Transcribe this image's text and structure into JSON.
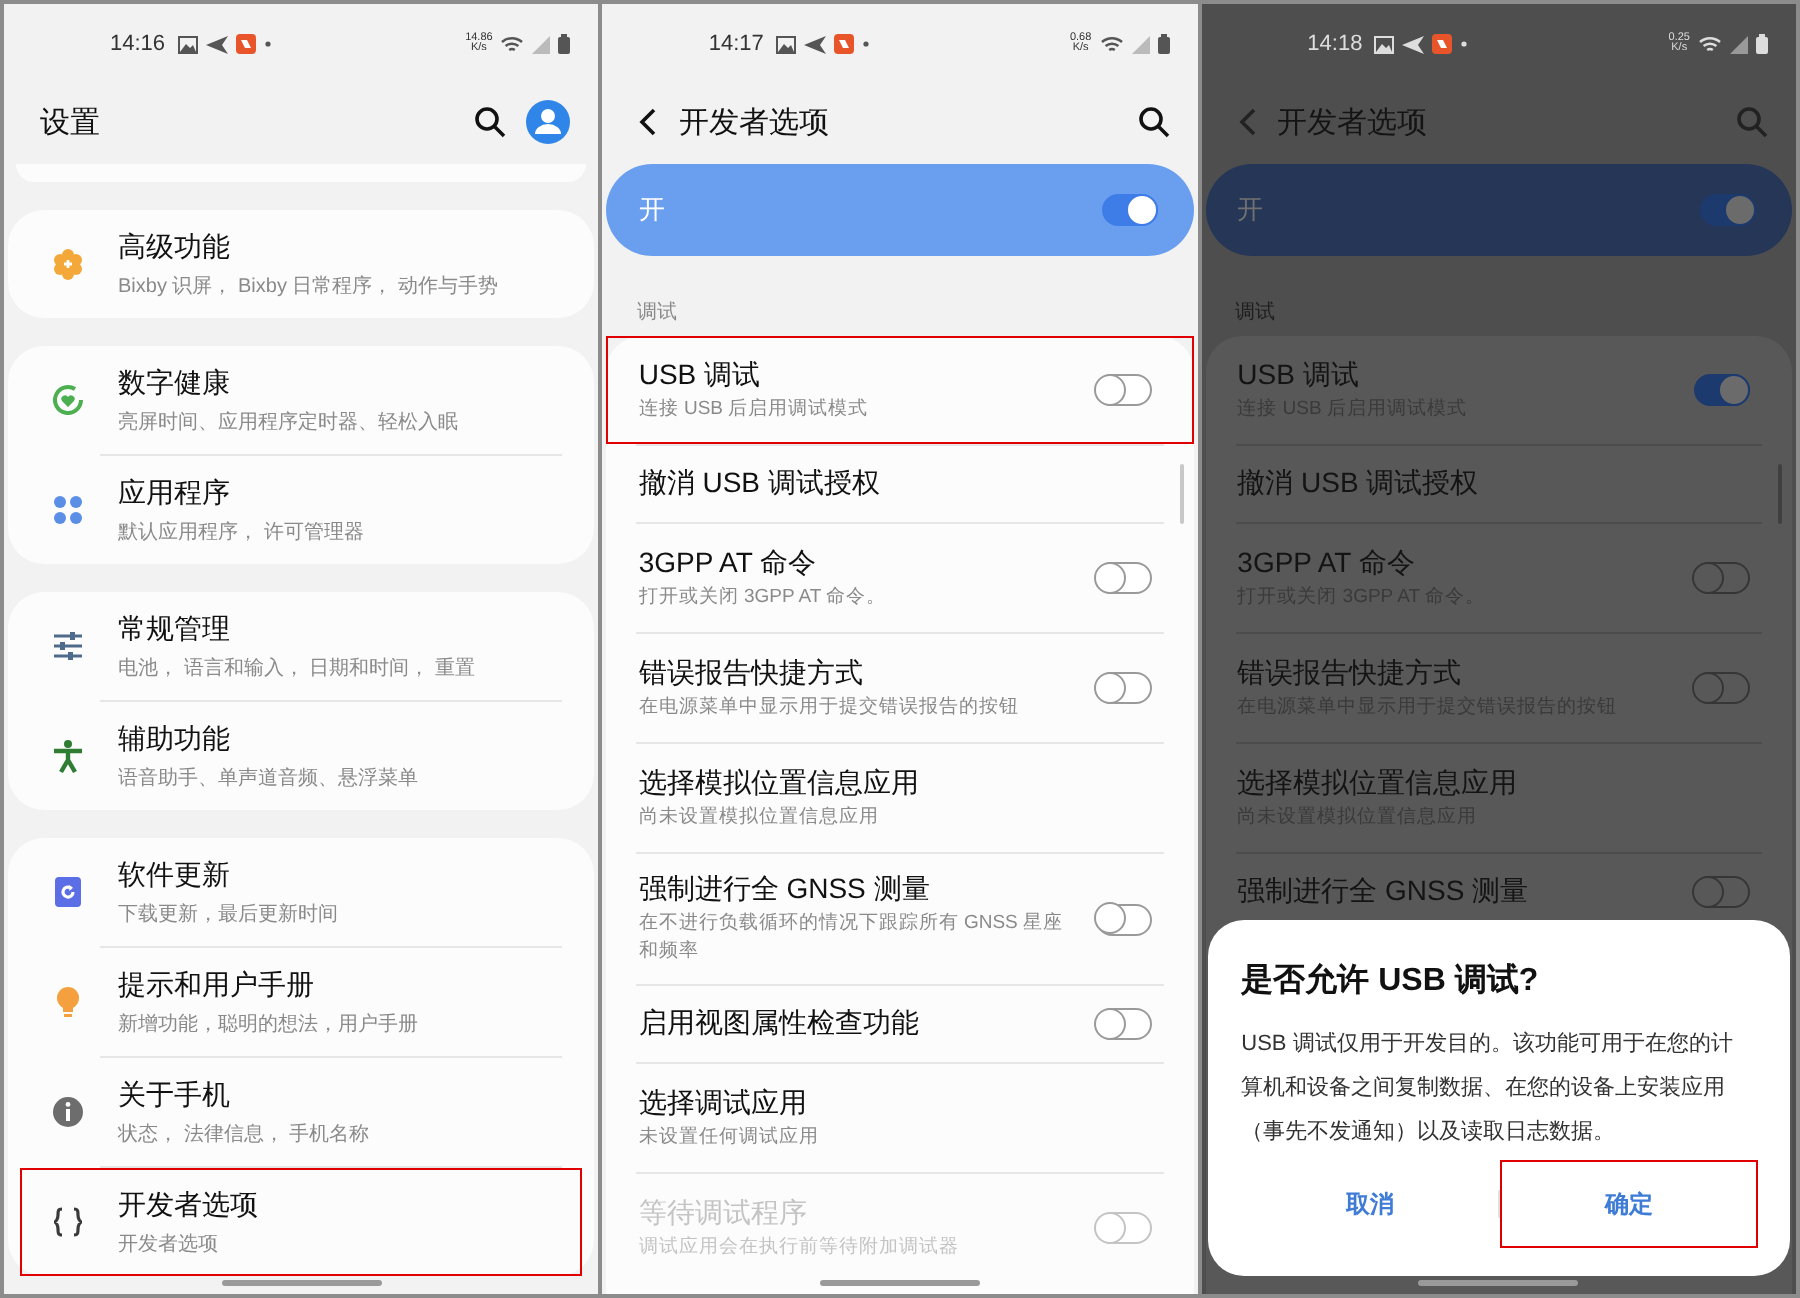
{
  "screens": [
    {
      "kind": "settings",
      "dimmed": false,
      "status_bar": {
        "time": "14:16",
        "speed": "14.86",
        "speed_unit": "K/s"
      },
      "title": "设置",
      "groups": [
        {
          "items": [
            {
              "kind": "gear",
              "title": "高级功能",
              "subtitle": "Bixby 识屏， Bixby 日常程序， 动作与手势",
              "highlighted": false
            }
          ]
        },
        {
          "items": [
            {
              "kind": "health",
              "title": "数字健康",
              "subtitle": "亮屏时间、应用程序定时器、轻松入眠",
              "highlighted": false
            },
            {
              "kind": "apps",
              "title": "应用程序",
              "subtitle": "默认应用程序， 许可管理器",
              "highlighted": false
            }
          ]
        },
        {
          "items": [
            {
              "kind": "sliders",
              "title": "常规管理",
              "subtitle": "电池， 语言和输入， 日期和时间， 重置",
              "highlighted": false
            },
            {
              "kind": "person",
              "title": "辅助功能",
              "subtitle": "语音助手、单声道音频、悬浮菜单",
              "highlighted": false
            }
          ]
        },
        {
          "items": [
            {
              "kind": "update",
              "title": "软件更新",
              "subtitle": "下载更新，最后更新时间",
              "highlighted": false
            },
            {
              "kind": "bulb",
              "title": "提示和用户手册",
              "subtitle": "新增功能，聪明的想法，用户手册",
              "highlighted": false
            },
            {
              "kind": "info",
              "title": "关于手机",
              "subtitle": "状态， 法律信息， 手机名称",
              "highlighted": false
            },
            {
              "kind": "braces",
              "title": "开发者选项",
              "subtitle": "开发者选项",
              "highlighted": true
            }
          ]
        }
      ]
    },
    {
      "kind": "developer",
      "dimmed": false,
      "status_bar": {
        "time": "14:17",
        "speed": "0.68",
        "speed_unit": "K/s"
      },
      "title": "开发者选项",
      "master": {
        "label": "开",
        "on": true
      },
      "section": "调试",
      "items": [
        {
          "kind": "switch",
          "title": "USB 调试",
          "subtitle": "连接 USB 后启用调试模式",
          "on": false,
          "disabled": false,
          "highlighted": true
        },
        {
          "kind": "link",
          "title": "撤消 USB 调试授权",
          "disabled": false,
          "highlighted": false
        },
        {
          "kind": "switch",
          "title": "3GPP AT 命令",
          "subtitle": "打开或关闭 3GPP AT 命令。",
          "on": false,
          "disabled": false,
          "highlighted": false
        },
        {
          "kind": "switch",
          "title": "错误报告快捷方式",
          "subtitle": "在电源菜单中显示用于提交错误报告的按钮",
          "on": false,
          "disabled": false,
          "highlighted": false
        },
        {
          "kind": "link",
          "title": "选择模拟位置信息应用",
          "subtitle": "尚未设置模拟位置信息应用",
          "disabled": false,
          "highlighted": false
        },
        {
          "kind": "switch",
          "title": "强制进行全 GNSS 测量",
          "subtitle": "在不进行负载循环的情况下跟踪所有 GNSS 星座和频率",
          "on": false,
          "disabled": false,
          "highlighted": false
        },
        {
          "kind": "switch",
          "title": "启用视图属性检查功能",
          "on": false,
          "disabled": false,
          "highlighted": false
        },
        {
          "kind": "link",
          "title": "选择调试应用",
          "subtitle": "未设置任何调试应用",
          "disabled": false,
          "highlighted": false
        },
        {
          "kind": "switch",
          "title": "等待调试程序",
          "subtitle": "调试应用会在执行前等待附加调试器",
          "on": false,
          "disabled": true,
          "highlighted": false
        }
      ]
    },
    {
      "kind": "developer",
      "dimmed": true,
      "status_bar": {
        "time": "14:18",
        "speed": "0.25",
        "speed_unit": "K/s"
      },
      "title": "开发者选项",
      "master": {
        "label": "开",
        "on": true
      },
      "section": "调试",
      "items": [
        {
          "kind": "switch",
          "title": "USB 调试",
          "subtitle": "连接 USB 后启用调试模式",
          "on": true,
          "disabled": false,
          "highlighted": false
        },
        {
          "kind": "link",
          "title": "撤消 USB 调试授权",
          "disabled": false,
          "highlighted": false
        },
        {
          "kind": "switch",
          "title": "3GPP AT 命令",
          "subtitle": "打开或关闭 3GPP AT 命令。",
          "on": false,
          "disabled": false,
          "highlighted": false
        },
        {
          "kind": "switch",
          "title": "错误报告快捷方式",
          "subtitle": "在电源菜单中显示用于提交错误报告的按钮",
          "on": false,
          "disabled": false,
          "highlighted": false
        },
        {
          "kind": "link",
          "title": "选择模拟位置信息应用",
          "subtitle": "尚未设置模拟位置信息应用",
          "disabled": false,
          "highlighted": false
        },
        {
          "kind": "switch",
          "title": "强制进行全 GNSS 测量",
          "on": false,
          "disabled": false,
          "highlighted": false
        }
      ],
      "dialog": {
        "title": "是否允许 USB 调试?",
        "body": "USB 调试仅用于开发目的。该功能可用于在您的计算机和设备之间复制数据、在您的设备上安装应用（事先不发通知）以及读取日志数据。",
        "buttons": [
          {
            "label": "取消",
            "highlighted": false
          },
          {
            "label": "确定",
            "highlighted": true
          }
        ]
      }
    }
  ]
}
